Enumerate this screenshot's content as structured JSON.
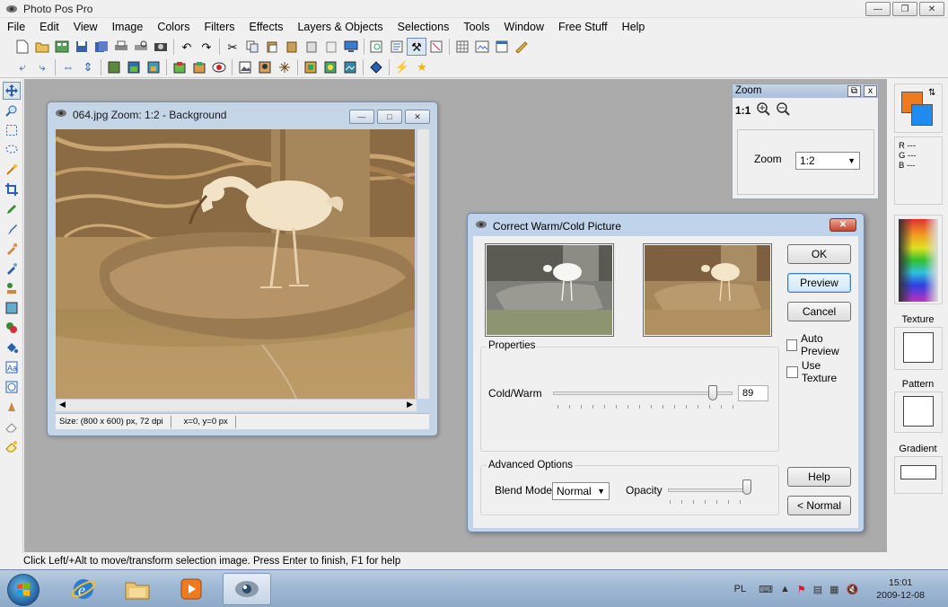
{
  "app": {
    "title": "Photo Pos Pro",
    "window_buttons": [
      "—",
      "❐",
      "✕"
    ]
  },
  "menu": [
    "File",
    "Edit",
    "View",
    "Image",
    "Colors",
    "Filters",
    "Effects",
    "Layers & Objects",
    "Selections",
    "Tools",
    "Window",
    "Free Stuff",
    "Help"
  ],
  "toolbar1_icons": [
    "new-doc-icon",
    "open-folder-icon",
    "browse-icon",
    "save-icon",
    "save-all-icon",
    "print-icon",
    "print-preview-icon",
    "scan-icon",
    "undo-icon",
    "redo-icon",
    "cut-icon",
    "copy-icon",
    "paste-icon",
    "paste-new-icon",
    "paste-layer-icon",
    "clear-icon",
    "screen-capture-icon",
    "zoom-window-icon",
    "properties-icon",
    "tools-icon",
    "settings-icon",
    "grid-icon",
    "thumbnails-icon",
    "layers-panel-icon",
    "ruler-icon"
  ],
  "toolbar2_icons": [
    "rotate-left-icon",
    "rotate-right-icon",
    "flip-horizontal-icon",
    "flip-vertical-icon",
    "canvas-size-icon",
    "image-size-icon",
    "crop-icon",
    "layer-add-icon",
    "layer-merge-icon",
    "red-eye-icon",
    "frame-icon",
    "mask-icon",
    "effects-icon",
    "color-balance-icon",
    "adjust-icon",
    "enhance-icon",
    "sharpen-icon",
    "lightning-icon",
    "star-icon"
  ],
  "tools": [
    "move-icon",
    "zoom-tool-icon",
    "rect-select-icon",
    "lasso-icon",
    "magic-wand-icon",
    "crop-tool-icon",
    "pencil-icon",
    "brush-icon",
    "airbrush-icon",
    "clone-icon",
    "stamp-icon",
    "picture-tube-icon",
    "clone-brush-icon",
    "fill-icon",
    "text-icon",
    "shape-icon",
    "smudge-icon",
    "eraser-icon",
    "magic-eraser-icon"
  ],
  "document": {
    "title": "064.jpg  Zoom: 1:2 - Background",
    "size_info": "Size: (800 x 600) px, 72 dpi",
    "coords": "x=0, y=0 px"
  },
  "zoom_panel": {
    "title": "Zoom",
    "one_to_one": "1:1",
    "zoom_label": "Zoom",
    "zoom_value": "1:2"
  },
  "dialog": {
    "title": "Correct Warm/Cold Picture",
    "ok": "OK",
    "preview": "Preview",
    "cancel": "Cancel",
    "auto_preview": "Auto Preview",
    "use_texture": "Use Texture",
    "properties_label": "Properties",
    "cold_warm_label": "Cold/Warm",
    "cold_warm_value": "89",
    "cold_warm_level": 0.89,
    "advanced_label": "Advanced Options",
    "blend_mode_label": "Blend Mode",
    "blend_mode_value": "Normal",
    "opacity_label": "Opacity",
    "opacity_level": 1.0,
    "help": "Help",
    "normal": "< Normal"
  },
  "right_panel": {
    "rgb": [
      "R ---",
      "G ---",
      "B ---"
    ],
    "texture": "Texture",
    "pattern": "Pattern",
    "gradient": "Gradient",
    "fg_color": "#f07a1e",
    "bg_color": "#1e8cf0"
  },
  "status": "Click Left/+Alt to move/transform selection image. Press Enter to finish, F1 for help",
  "taskbar": {
    "apps": [
      "ie-icon",
      "explorer-icon",
      "media-player-icon",
      "photo-pos-icon"
    ],
    "lang": "PL",
    "time": "15:01",
    "date": "2009-12-08"
  }
}
